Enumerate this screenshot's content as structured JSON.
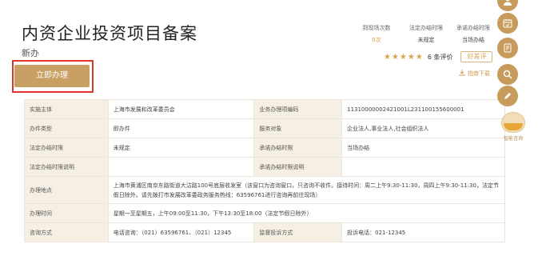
{
  "header": {
    "title": "内资企业投资项目备案",
    "subtitle": "新办",
    "apply_label": "立即办理"
  },
  "stats": [
    {
      "label": "到现场次数",
      "value": "0次",
      "highlight": true
    },
    {
      "label": "法定办结时限",
      "value": "未规定",
      "highlight": false
    },
    {
      "label": "承诺办结时限",
      "value": "当场办结",
      "highlight": false
    }
  ],
  "rating": {
    "stars": "★★★★★",
    "count_text": "6 条评价",
    "review_label": "好差评"
  },
  "guide": {
    "label": "指南下载",
    "icon": "download-icon"
  },
  "table": {
    "rows": [
      {
        "k1": "实施主体",
        "v1": "上海市发展和改革委员会",
        "k2": "业务办理项编码",
        "v2": "11310000002421001L231100155600001"
      },
      {
        "k1": "办件类型",
        "v1": "即办件",
        "k2": "服务对象",
        "v2": "企业法人,事业法人,社会组织法人"
      },
      {
        "k1": "法定办结时限",
        "v1": "未规定",
        "k2": "承诺办结时限",
        "v2": "当场办结"
      },
      {
        "k1": "法定办结时限说明",
        "v1": "",
        "k2": "承诺办结时限说明",
        "v2": ""
      },
      {
        "k1": "办理地点",
        "full": "上海市黄浦区南京东路街道大沽路100号底层收发室（该窗口为咨询窗口，只咨询不收件。接待时间：周二上午9:30-11:30，周四上午9:30-11:30，法定节假日除外。请先拨打市发展改革委政务服务热线：63596761进行咨询再前往现场）"
      },
      {
        "k1": "办理时间",
        "full": "星期一至星期五，上午09:00至11:30，下午13:30至18:00（法定节假日除外）"
      },
      {
        "k1": "咨询方式",
        "v1": "电话咨询：（021）63596761、（021）12345",
        "k2": "监督投诉方式",
        "v2": "投诉电话：021-12345"
      }
    ]
  },
  "sidebar": {
    "icons": [
      "user-icon",
      "calendar-icon",
      "document-icon",
      "search-icon",
      "edit-icon"
    ],
    "assistant_label": "智能咨询"
  },
  "colors": {
    "accent": "#c8a064",
    "highlight_border": "#e0352b",
    "header_cell": "#f6f0e4"
  }
}
